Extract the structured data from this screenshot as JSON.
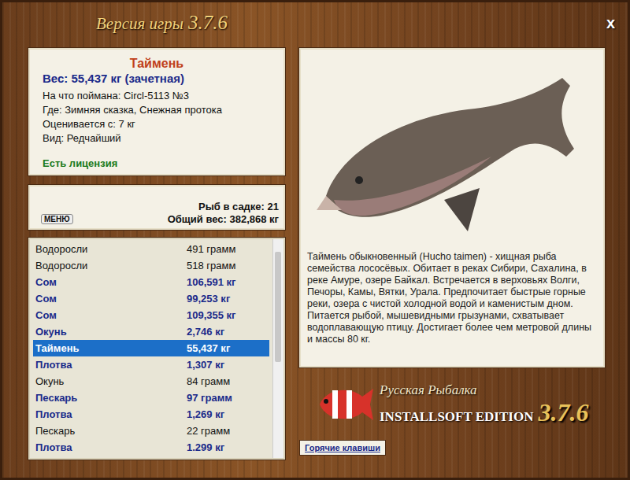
{
  "window": {
    "title": "Версия игры",
    "version": "3.7.6",
    "close": "x"
  },
  "fish": {
    "name": "Таймень",
    "weight": "Вес: 55,437 кг (зачетная)",
    "details": [
      "На что поймана: Circl-5113 №3",
      "Где: Зимняя сказка, Снежная протока",
      "Оценивается с: 7 кг",
      "Вид: Редчайший"
    ],
    "license": "Есть лицензия"
  },
  "summary": {
    "menu_button": "МЕНЮ",
    "count": "Рыб в садке: 21",
    "total": "Общий вес: 382,868 кг"
  },
  "catch_list": [
    {
      "name": "Водоросли",
      "weight": "491 грамм",
      "trophy": false,
      "selected": false
    },
    {
      "name": "Водоросли",
      "weight": "518 грамм",
      "trophy": false,
      "selected": false
    },
    {
      "name": "Сом",
      "weight": "106,591 кг",
      "trophy": true,
      "selected": false
    },
    {
      "name": "Сом",
      "weight": "99,253 кг",
      "trophy": true,
      "selected": false
    },
    {
      "name": "Сом",
      "weight": "109,355 кг",
      "trophy": true,
      "selected": false
    },
    {
      "name": "Окунь",
      "weight": "2,746 кг",
      "trophy": true,
      "selected": false
    },
    {
      "name": "Таймень",
      "weight": "55,437 кг",
      "trophy": true,
      "selected": true
    },
    {
      "name": "Плотва",
      "weight": "1,307 кг",
      "trophy": true,
      "selected": false
    },
    {
      "name": "Окунь",
      "weight": "84 грамм",
      "trophy": false,
      "selected": false
    },
    {
      "name": "Пескарь",
      "weight": "97 грамм",
      "trophy": true,
      "selected": false
    },
    {
      "name": "Плотва",
      "weight": "1,269 кг",
      "trophy": true,
      "selected": false
    },
    {
      "name": "Пескарь",
      "weight": "22 грамм",
      "trophy": false,
      "selected": false
    },
    {
      "name": "Плотва",
      "weight": "1.299 кг",
      "trophy": true,
      "selected": false
    }
  ],
  "description": "Таймень обыкновенный (Hucho taimen) - хищная рыба семейства лососёвых. Обитает в реках Сибири, Сахалина, в реке Амуре, озере Байкал. Встречается в верховьях Волги, Печоры, Камы, Вятки, Урала. Предпочитает быстрые горные реки, озера с чистой холодной водой и каменистым дном. Питается рыбой, мышевидными грызунами, схватывает водоплавающую птицу. Достигает более чем метровой длины и массы 80 кг.",
  "logo": {
    "title": "Русская Рыбалка",
    "edition": "INSTALLSOFT EDITION",
    "version": "3.7.6"
  },
  "hotkeys_button": "Горячие клавиши"
}
